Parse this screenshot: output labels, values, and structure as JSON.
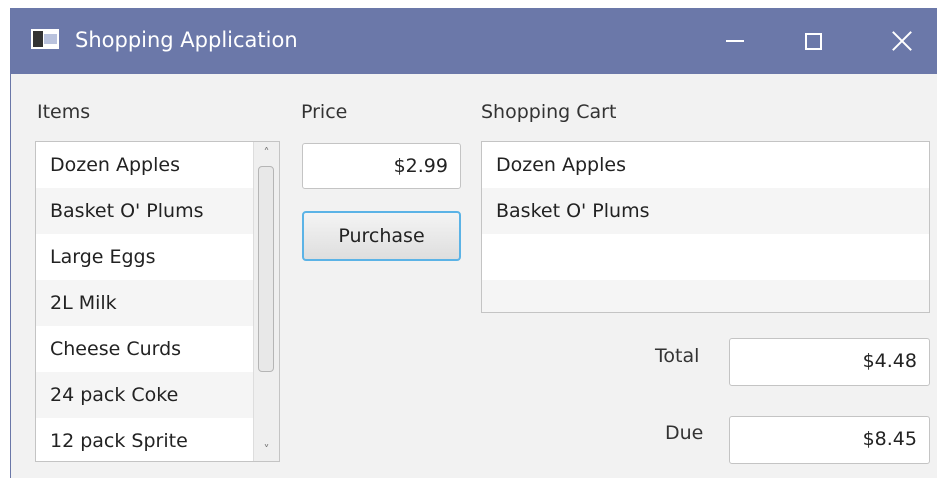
{
  "window": {
    "title": "Shopping Application",
    "icons": {
      "app": "app-window-icon",
      "minimize": "minimize-icon",
      "maximize": "maximize-icon",
      "close": "close-icon"
    }
  },
  "labels": {
    "items": "Items",
    "price": "Price",
    "cart": "Shopping Cart",
    "total": "Total",
    "due": "Due"
  },
  "items_list": {
    "entries": [
      "Dozen Apples",
      "Basket O' Plums",
      "Large Eggs",
      "2L Milk",
      "Cheese Curds",
      "24 pack Coke",
      "12 pack Sprite"
    ]
  },
  "price_field": {
    "value": "$2.99"
  },
  "purchase_button": {
    "label": "Purchase"
  },
  "cart_list": {
    "entries": [
      "Dozen Apples",
      "Basket O' Plums",
      "",
      ""
    ]
  },
  "total_field": {
    "value": "$4.48"
  },
  "due_field": {
    "value": "$8.45"
  }
}
